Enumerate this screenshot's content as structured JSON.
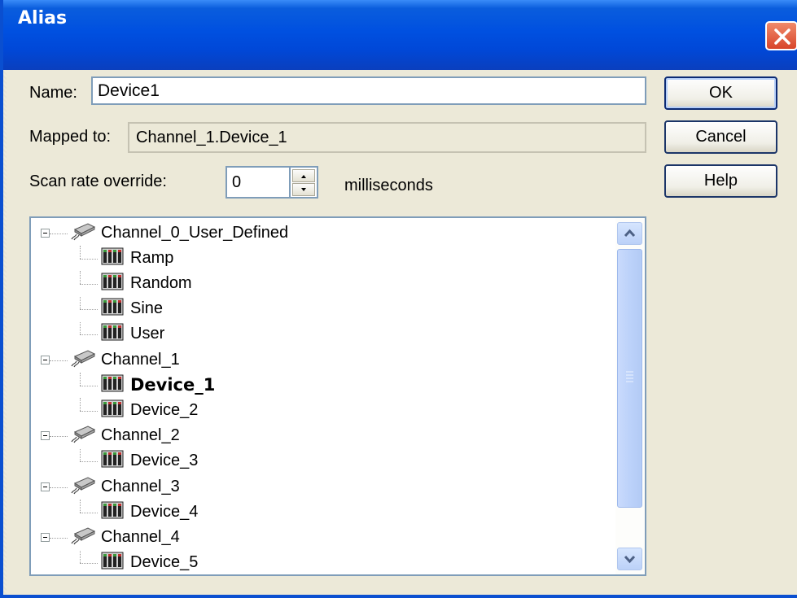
{
  "window": {
    "title": "Alias"
  },
  "form": {
    "name_label": "Name:",
    "name_value": "Device1",
    "mapped_label": "Mapped to:",
    "mapped_value": "Channel_1.Device_1",
    "scan_label": "Scan rate override:",
    "scan_value": "0",
    "scan_unit": "milliseconds"
  },
  "buttons": {
    "ok": "OK",
    "cancel": "Cancel",
    "help": "Help"
  },
  "tree": {
    "rows": [
      {
        "label": "Channel_0_User_Defined",
        "type": "channel"
      },
      {
        "label": "Ramp",
        "type": "device"
      },
      {
        "label": "Random",
        "type": "device"
      },
      {
        "label": "Sine",
        "type": "device"
      },
      {
        "label": "User",
        "type": "device"
      },
      {
        "label": "Channel_1",
        "type": "channel"
      },
      {
        "label": "Device_1",
        "type": "device",
        "selected": true
      },
      {
        "label": "Device_2",
        "type": "device"
      },
      {
        "label": "Channel_2",
        "type": "channel"
      },
      {
        "label": "Device_3",
        "type": "device"
      },
      {
        "label": "Channel_3",
        "type": "channel"
      },
      {
        "label": "Device_4",
        "type": "device"
      },
      {
        "label": "Channel_4",
        "type": "channel"
      },
      {
        "label": "Device_5",
        "type": "device"
      }
    ]
  },
  "colors": {
    "title_bar": "#0050e0",
    "dialog_bg": "#ece9d8",
    "close_button": "#d8442a"
  }
}
